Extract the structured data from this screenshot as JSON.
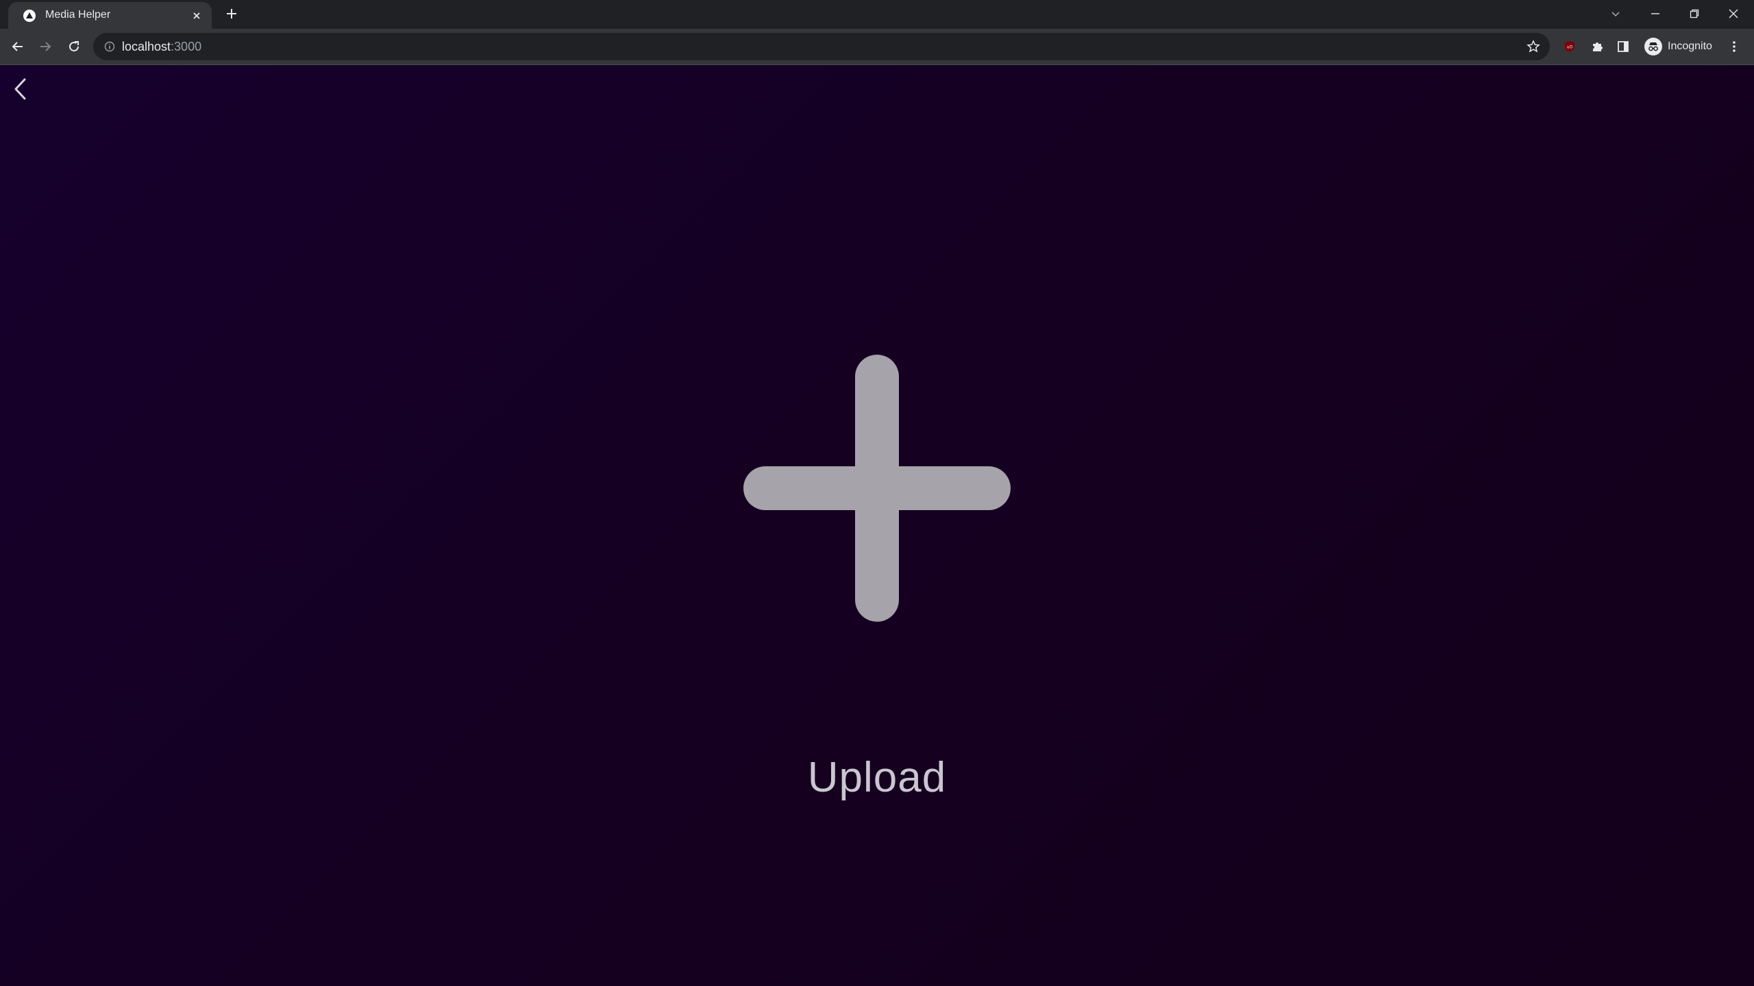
{
  "browser": {
    "tab": {
      "title": "Media Helper"
    },
    "address": {
      "host": "localhost",
      "port": ":3000"
    },
    "profile": {
      "label": "Incognito"
    }
  },
  "page": {
    "upload_label": "Upload"
  },
  "colors": {
    "background_start": "#16002d",
    "background_end": "#14001a",
    "plus_icon": "#a6a3ab",
    "upload_text": "#c9c6cf"
  },
  "icons": {
    "back": "chevron-left-icon",
    "upload": "plus-icon"
  }
}
